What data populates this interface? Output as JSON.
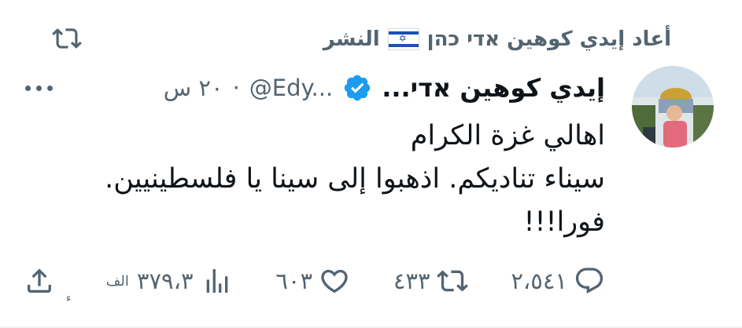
{
  "retweet": {
    "actor": "أعاد إيدي كوهين אדי כהן",
    "suffix": "النشر",
    "flag_symbol": "✡",
    "icon": "retweet-icon"
  },
  "author": {
    "name": "إيدي كوهين אדי...",
    "handle": "@Edy...",
    "time": "٢٠ س",
    "dot": "·",
    "verified_color": "#1d9bf0",
    "avatar_icon": "avatar-photo"
  },
  "body": {
    "lines": [
      "اهالي غزة الكرام",
      "سيناء تناديكم. اذهبوا إلى سينا يا فلسطينيين.",
      "فورا!!!"
    ]
  },
  "actions": {
    "replies": "٢،٥٤١",
    "retweets": "٤٣٣",
    "likes": "٦٠٣",
    "views": "٣٧٩،٣",
    "views_fragment": "الف",
    "share_fragment": "ء"
  },
  "colors": {
    "text": "#0f1419",
    "muted": "#536471",
    "accent": "#1d9bf0"
  }
}
